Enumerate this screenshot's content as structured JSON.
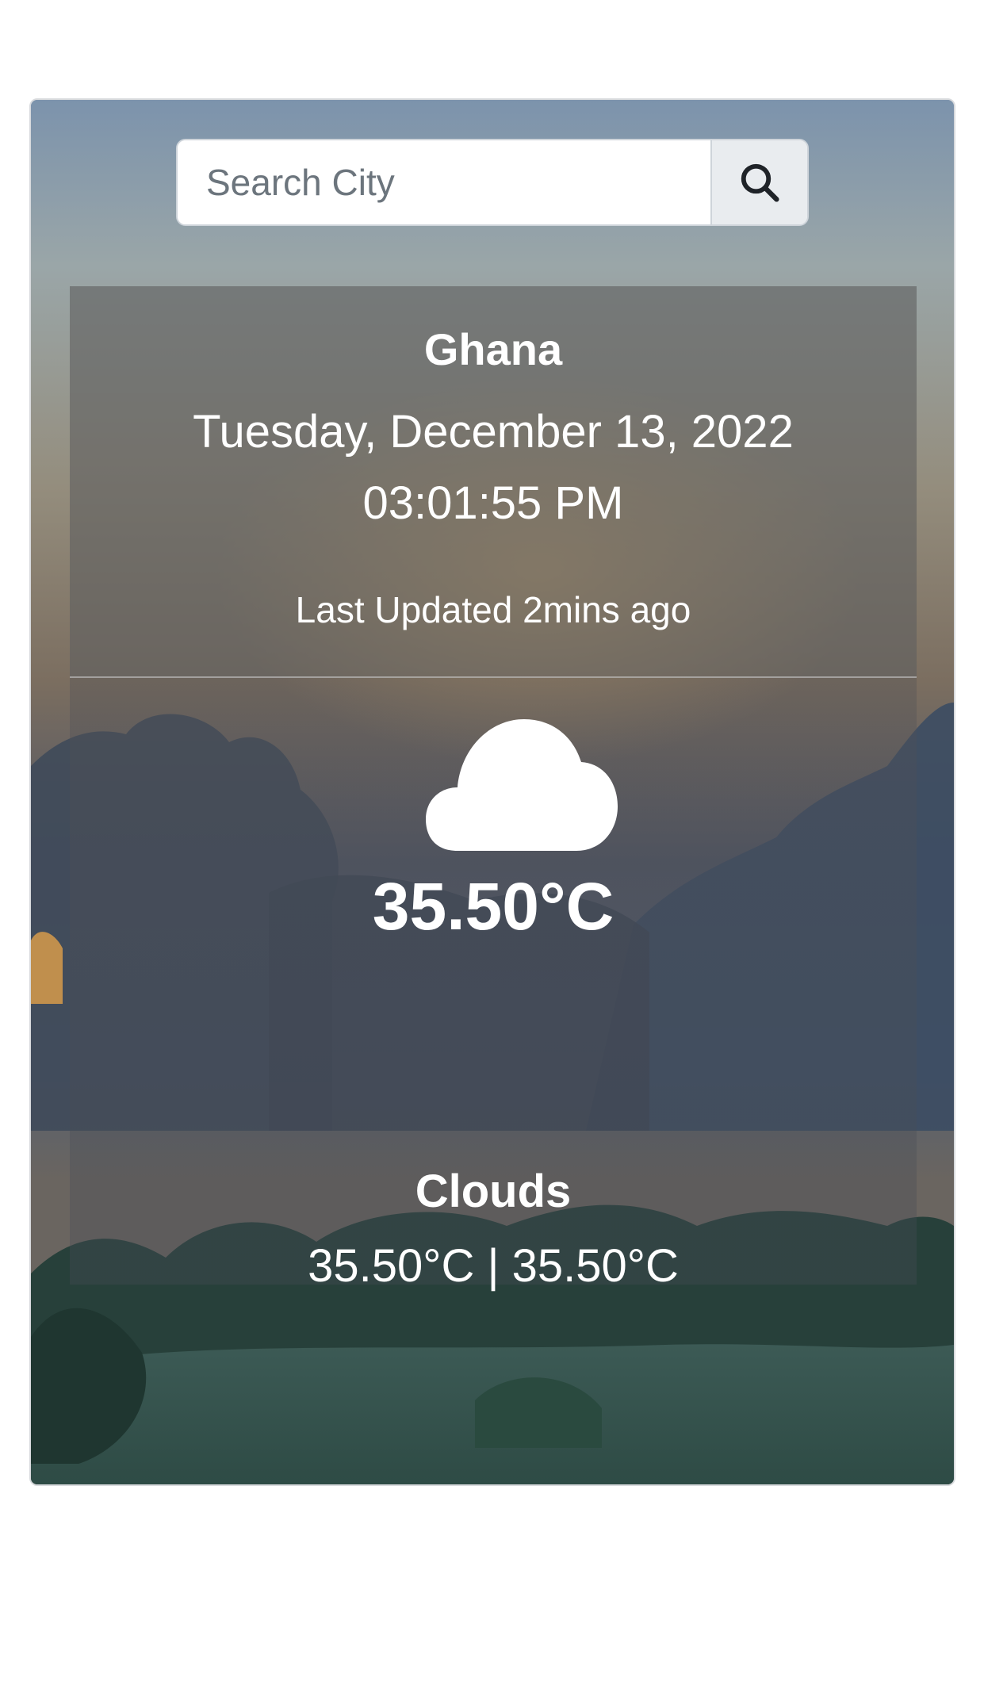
{
  "search": {
    "placeholder": "Search City",
    "icon": "search-icon"
  },
  "weather": {
    "city": "Ghana",
    "date": "Tuesday, December 13, 2022",
    "time": "03:01:55 PM",
    "last_updated": "Last Updated 2mins ago",
    "icon": "cloud-icon",
    "temperature": "35.50°C",
    "condition": "Clouds",
    "temp_range": "35.50°C | 35.50°C"
  },
  "colors": {
    "panel": "#5f5f5f",
    "text": "#ffffff",
    "input_border": "#ced4da",
    "button_bg": "#e9ecef"
  }
}
